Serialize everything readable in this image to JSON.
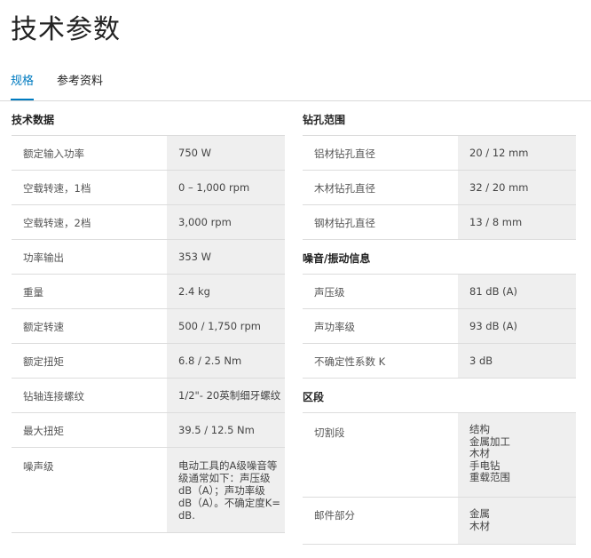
{
  "page": {
    "title": "技术参数"
  },
  "tabs": [
    {
      "label": "规格",
      "active": true
    },
    {
      "label": "参考资料",
      "active": false
    }
  ],
  "accent_color": "#007bc0",
  "tech_data": {
    "title": "技术数据",
    "rows": [
      {
        "label": "额定输入功率",
        "value": "750 W"
      },
      {
        "label": "空载转速，1档",
        "value": "0 – 1,000 rpm"
      },
      {
        "label": "空载转速，2档",
        "value": "3,000 rpm"
      },
      {
        "label": "功率输出",
        "value": "353 W"
      },
      {
        "label": "重量",
        "value": "2.4 kg"
      },
      {
        "label": "额定转速",
        "value": "500 / 1,750 rpm"
      },
      {
        "label": "额定扭矩",
        "value": "6.8 / 2.5 Nm"
      },
      {
        "label": "钻轴连接螺纹",
        "value": "1/2\"- 20英制细牙螺纹"
      },
      {
        "label": "最大扭矩",
        "value": "39.5 / 12.5 Nm"
      },
      {
        "label": "噪声级",
        "value_lines": [
          "电动工具的A级噪音等",
          "级通常如下：声压级",
          "dB（A）；声功率级",
          "dB（A）。不确定度K=",
          "dB."
        ]
      }
    ]
  },
  "drilling": {
    "title": "钻孔范围",
    "rows": [
      {
        "label": "铝材钻孔直径",
        "value": "20 / 12 mm"
      },
      {
        "label": "木材钻孔直径",
        "value": "32 / 20 mm"
      },
      {
        "label": "钢材钻孔直径",
        "value": "13 / 8 mm"
      }
    ]
  },
  "noise": {
    "title": "噪音/振动信息",
    "rows": [
      {
        "label": "声压级",
        "value": "81 dB (A)"
      },
      {
        "label": "声功率级",
        "value": "93 dB (A)"
      },
      {
        "label": "不确定性系数 K",
        "value": "3 dB"
      }
    ]
  },
  "segments": {
    "title": "区段",
    "rows": [
      {
        "label": "切割段",
        "value_lines": [
          "结构",
          "金属加工",
          "木材",
          "手电钻",
          "重载范围"
        ]
      },
      {
        "label": "邮件部分",
        "value_lines": [
          "金属",
          "木材"
        ]
      }
    ]
  }
}
